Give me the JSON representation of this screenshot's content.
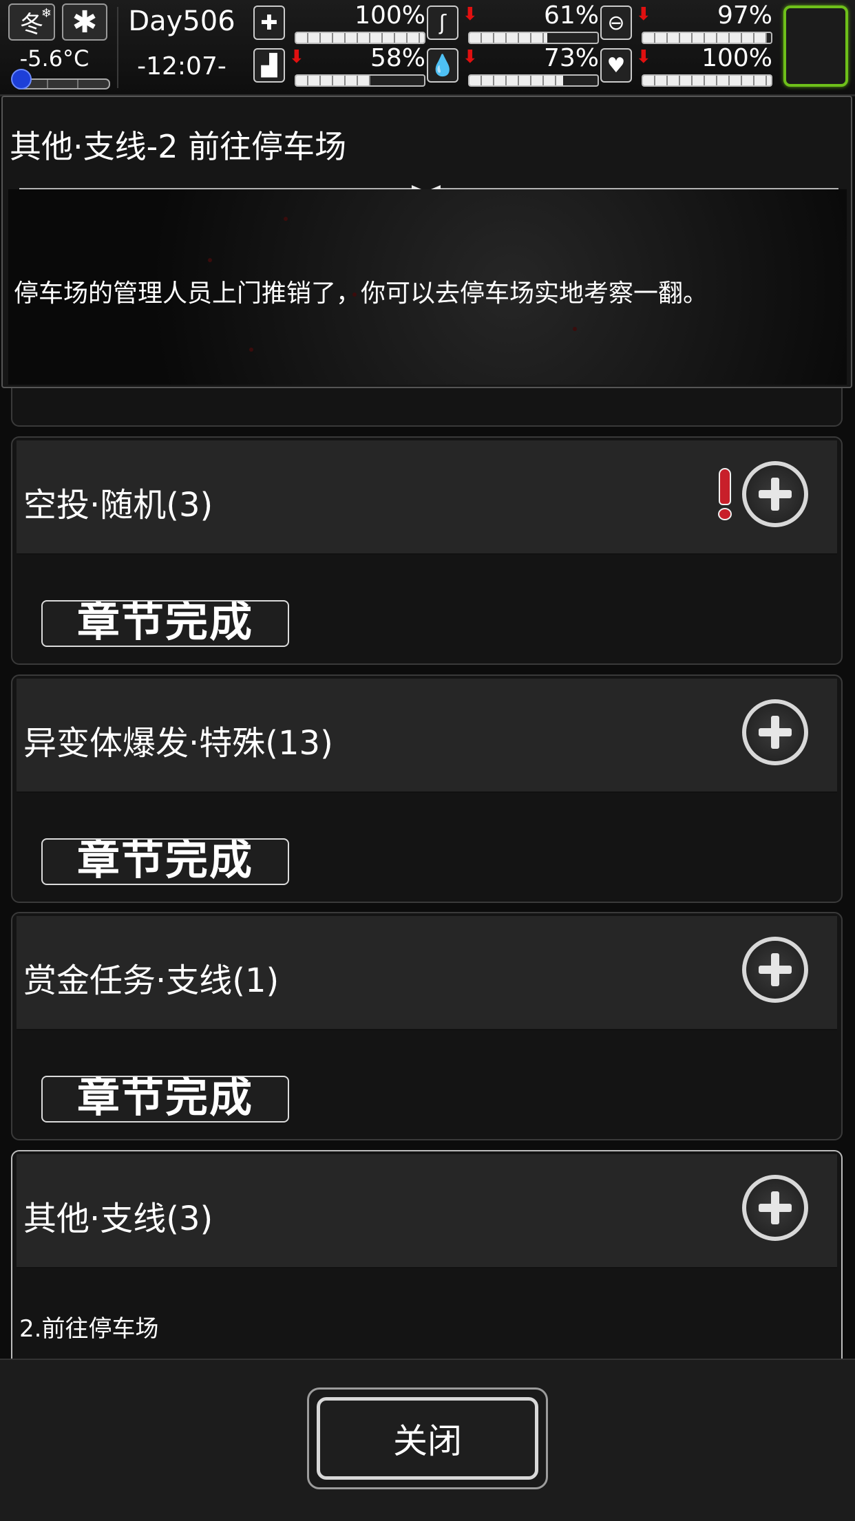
{
  "status": {
    "season": "冬",
    "temperature": "-5.6°C",
    "temperature_level": 0.05,
    "day": "Day506",
    "time": "-12:07-",
    "stats": [
      {
        "icon": "medkit-icon",
        "value": "100%",
        "level": 1.0,
        "decreasing": false
      },
      {
        "icon": "stomach-icon",
        "value": "61%",
        "level": 0.61,
        "decreasing": true
      },
      {
        "icon": "pill-icon",
        "value": "97%",
        "level": 0.97,
        "decreasing": true
      },
      {
        "icon": "foot-icon",
        "value": "58%",
        "level": 0.58,
        "decreasing": true
      },
      {
        "icon": "water-drop-icon",
        "value": "73%",
        "level": 0.73,
        "decreasing": true
      },
      {
        "icon": "heart-icon",
        "value": "100%",
        "level": 1.0,
        "decreasing": true
      }
    ],
    "portrait_border_color": "#6ec01a"
  },
  "detail": {
    "title": "其他·支线-2 前往停车场",
    "text": "停车场的管理人员上门推销了，你可以去停车场实地考察一翻。"
  },
  "quests": [
    {
      "title": "空投·随机(3)",
      "status": "章节完成",
      "has_alert": true
    },
    {
      "title": "异变体爆发·特殊(13)",
      "status": "章节完成",
      "has_alert": false
    },
    {
      "title": "赏金任务·支线(1)",
      "status": "章节完成",
      "has_alert": false
    },
    {
      "title": "其他·支线(3)",
      "subitem": "2.前往停车场",
      "has_alert": false
    }
  ],
  "close_label": "关闭"
}
